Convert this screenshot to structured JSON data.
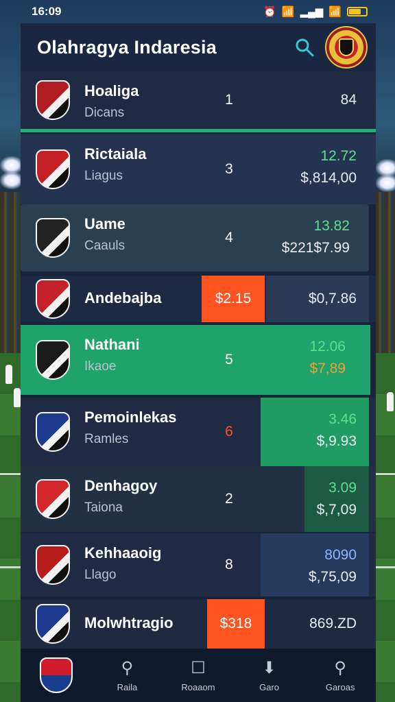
{
  "status_bar": {
    "time": "16:09",
    "icons": [
      "alarm-icon",
      "wifi-icon",
      "signal-icon",
      "wifi-icon",
      "battery-icon"
    ],
    "battery_level": 0.7
  },
  "header": {
    "title": "Olahragya Indaresia",
    "search_icon": "search-icon",
    "crest_icon": "crest-icon"
  },
  "rows": [
    {
      "name": "Hoaliga",
      "sub": "Dicans",
      "rank": "1",
      "v1": "84",
      "v2": "",
      "colors": {
        "bg": "#1e2b42",
        "logo": "#b01c22"
      }
    },
    {
      "name": "Rictaiala",
      "sub": "Liagus",
      "rank": "3",
      "v1": "12.72",
      "v2": "$,814,00",
      "colors": {
        "bg": "#243350",
        "logo": "#c32024"
      }
    },
    {
      "name": "Uame",
      "sub": "Caauls",
      "rank": "4",
      "v1": "13.82",
      "v2": "$221$7.99",
      "colors": {
        "bg": "#2a4050",
        "logo": "#222222"
      }
    },
    {
      "name": "Andebajba",
      "sub": "",
      "rank": "",
      "tag": "$2.15",
      "v1": "$0,7.86",
      "v2": "",
      "colors": {
        "bg": "#1c2a42",
        "logo": "#c3202a"
      }
    },
    {
      "name": "Nathani",
      "sub": "Ikaoe",
      "rank": "5",
      "v1": "12.06",
      "v2": "$7,89",
      "colors": {
        "bg": "#1fa26b",
        "logo": "#1b1b1b"
      }
    },
    {
      "name": "Pemoinlekas",
      "sub": "Ramles",
      "rank": "6",
      "v1": "3.46",
      "v2": "$,9.93",
      "colors": {
        "bg": "#1e2b42",
        "logo": "#1e3a8f"
      }
    },
    {
      "name": "Denhagoy",
      "sub": "Taiona",
      "rank": "2",
      "v1": "3.09",
      "v2": "$,7,09",
      "colors": {
        "bg": "#223044",
        "logo": "#d2262a"
      }
    },
    {
      "name": "Kehhaaoig",
      "sub": "Llago",
      "rank": "8",
      "v1": "8090",
      "v2": "$,75,09",
      "colors": {
        "bg": "#1e2b42",
        "logo": "#b71c1c"
      }
    },
    {
      "name": "Molwhtragio",
      "sub": "",
      "rank": "",
      "tag": "$318",
      "v1": "869.ZD",
      "v2": "",
      "colors": {
        "bg": "#1d2a40",
        "logo": "#1e3a8f"
      }
    }
  ],
  "nav": [
    {
      "label": "",
      "icon": "team-logo-icon"
    },
    {
      "label": "Raila",
      "icon": "search-icon"
    },
    {
      "label": "Roaaom",
      "icon": "square-icon"
    },
    {
      "label": "Garo",
      "icon": "download-icon"
    },
    {
      "label": "Garoas",
      "icon": "search-icon"
    }
  ],
  "colors": {
    "accent": "#1fb074",
    "orange": "#ff5320",
    "green_value": "#5fe08a",
    "blue_value": "#8ab8ff"
  }
}
